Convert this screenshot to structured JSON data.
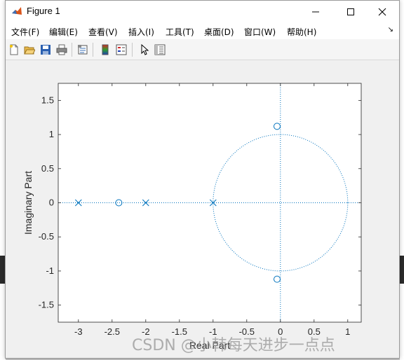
{
  "window": {
    "title": "Figure 1"
  },
  "menu": {
    "items": [
      "文件(F)",
      "编辑(E)",
      "查看(V)",
      "插入(I)",
      "工具(T)",
      "桌面(D)",
      "窗口(W)",
      "帮助(H)"
    ],
    "overflow": "↘"
  },
  "toolbar": {
    "icons": [
      "new-figure-icon",
      "open-file-icon",
      "save-icon",
      "print-icon",
      "link-plot-icon",
      "colorbar-icon",
      "legend-icon",
      "edit-plot-arrow-icon",
      "property-inspector-icon"
    ]
  },
  "chart_data": {
    "type": "scatter",
    "title": "",
    "xlabel": "Real Part",
    "ylabel": "Imaginary Part",
    "xlim": [
      -3.3,
      1.2
    ],
    "ylim": [
      -1.75,
      1.75
    ],
    "xticks": [
      "-3",
      "-2.5",
      "-2",
      "-1.5",
      "-1",
      "-0.5",
      "0",
      "0.5",
      "1"
    ],
    "yticks": [
      "-1.5",
      "-1",
      "-0.5",
      "0",
      "0.5",
      "1",
      "1.5"
    ],
    "grid": false,
    "color": "#0072bd",
    "unit_circle": true,
    "zeros": [
      {
        "x": -2.4,
        "y": 0
      },
      {
        "x": -0.05,
        "y": 1.12
      },
      {
        "x": -0.05,
        "y": -1.12
      }
    ],
    "poles": [
      {
        "x": -3,
        "y": 0
      },
      {
        "x": -2,
        "y": 0
      },
      {
        "x": -1,
        "y": 0
      }
    ]
  },
  "watermark": "CSDN @小韩每天进步一点点"
}
